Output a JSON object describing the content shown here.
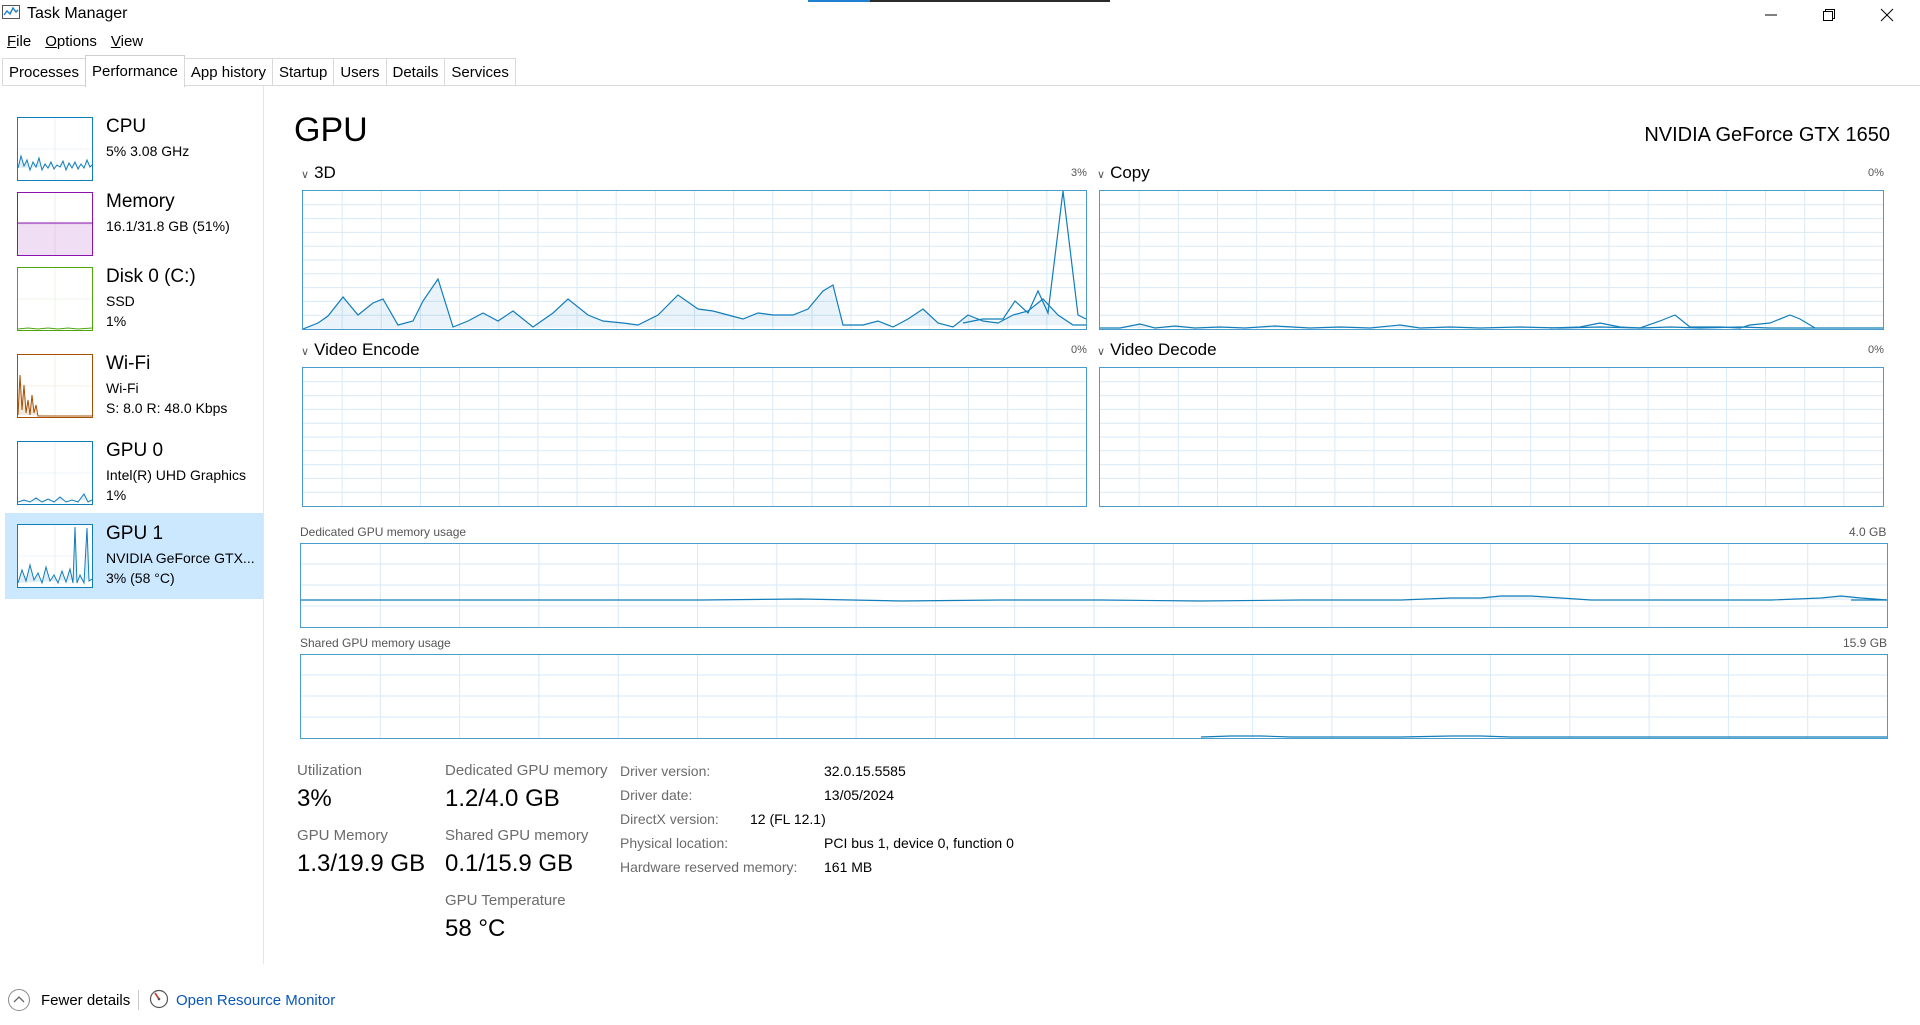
{
  "window": {
    "title": "Task Manager",
    "controls": [
      "minimize-icon",
      "maximize-icon",
      "close-icon"
    ]
  },
  "menu": {
    "file": {
      "u": "F",
      "rest": "ile"
    },
    "options": {
      "u": "O",
      "rest": "ptions"
    },
    "view": {
      "u": "V",
      "rest": "iew"
    }
  },
  "tabs": [
    "Processes",
    "Performance",
    "App history",
    "Startup",
    "Users",
    "Details",
    "Services"
  ],
  "active_tab": "Performance",
  "sidebar": {
    "items": [
      {
        "title": "CPU",
        "sub1": "5% 3.08 GHz",
        "sub2": "",
        "color": "#117dbb"
      },
      {
        "title": "Memory",
        "sub1": "16.1/31.8 GB (51%)",
        "sub2": "",
        "color": "#8b12ae"
      },
      {
        "title": "Disk 0 (C:)",
        "sub1": "SSD",
        "sub2": "1%",
        "color": "#4da60c"
      },
      {
        "title": "Wi-Fi",
        "sub1": "Wi-Fi",
        "sub2": "S: 8.0  R: 48.0 Kbps",
        "color": "#a74f01"
      },
      {
        "title": "GPU 0",
        "sub1": "Intel(R) UHD Graphics",
        "sub2": "1%",
        "color": "#117dbb"
      },
      {
        "title": "GPU 1",
        "sub1": "NVIDIA GeForce GTX...",
        "sub2": "3% (58 °C)",
        "color": "#117dbb"
      }
    ],
    "selected": "GPU 1"
  },
  "main": {
    "title": "GPU",
    "device_name": "NVIDIA GeForce GTX 1650",
    "panels": {
      "p3d": {
        "label": "3D",
        "pct": "3%"
      },
      "copy": {
        "label": "Copy",
        "pct": "0%"
      },
      "encode": {
        "label": "Video Encode",
        "pct": "0%"
      },
      "decode": {
        "label": "Video Decode",
        "pct": "0%"
      }
    },
    "dedicated_graph": {
      "label": "Dedicated GPU memory usage",
      "max": "4.0 GB"
    },
    "shared_graph": {
      "label": "Shared GPU memory usage",
      "max": "15.9 GB"
    },
    "stats": {
      "utilization_label": "Utilization",
      "utilization": "3%",
      "dedicated_label": "Dedicated GPU memory",
      "dedicated": "1.2/4.0 GB",
      "gpu_memory_label": "GPU Memory",
      "gpu_memory": "1.3/19.9 GB",
      "shared_label": "Shared GPU memory",
      "shared": "0.1/15.9 GB",
      "temp_label": "GPU Temperature",
      "temp": "58 °C"
    },
    "info": {
      "driver_version_label": "Driver version:",
      "driver_version": "32.0.15.5585",
      "driver_date_label": "Driver date:",
      "driver_date": "13/05/2024",
      "directx_label": "DirectX version:",
      "directx": "12 (FL 12.1)",
      "location_label": "Physical location:",
      "location": "PCI bus 1, device 0, function 0",
      "reserved_label": "Hardware reserved memory:",
      "reserved": "161 MB"
    }
  },
  "footer": {
    "fewer_details": "Fewer details",
    "open_resource_monitor": "Open Resource Monitor"
  },
  "colors": {
    "graph_line": "#117dbb",
    "graph_border": "#4a9ccc",
    "grid": "#d9eaf7",
    "selected_bg": "#cce8ff"
  }
}
